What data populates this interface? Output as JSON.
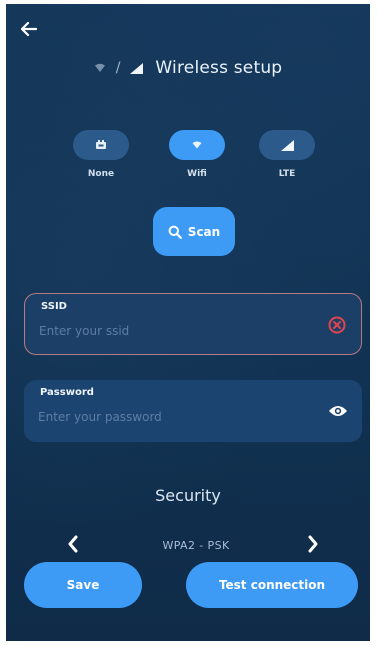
{
  "header": {
    "back_icon": "arrow-left-icon",
    "breadcrumb_icon": "wifi-icon",
    "separator": "/",
    "title_icon": "signal-bars-icon",
    "title": "Wireless setup"
  },
  "modes": {
    "selected": "Wifi",
    "items": [
      {
        "label": "None",
        "icon": "ethernet-icon"
      },
      {
        "label": "Wifi",
        "icon": "wifi-icon"
      },
      {
        "label": "LTE",
        "icon": "signal-bars-icon"
      }
    ]
  },
  "scan": {
    "label": "Scan",
    "icon": "search-icon"
  },
  "ssid": {
    "label": "SSID",
    "value": "",
    "placeholder": "Enter your ssid",
    "status_icon": "error-circle-x-icon"
  },
  "password": {
    "label": "Password",
    "value": "",
    "placeholder": "Enter your password",
    "toggle_icon": "eye-icon"
  },
  "security": {
    "title": "Security",
    "value": "WPA2 - PSK",
    "prev_icon": "chevron-left-icon",
    "next_icon": "chevron-right-icon"
  },
  "actions": {
    "save_label": "Save",
    "test_label": "Test connection"
  },
  "colors": {
    "background": "#123252",
    "accent": "#3d9bf6",
    "pill_inactive": "#2b5a8b",
    "field_bg": "#1a4068",
    "error": "#e0454f"
  }
}
